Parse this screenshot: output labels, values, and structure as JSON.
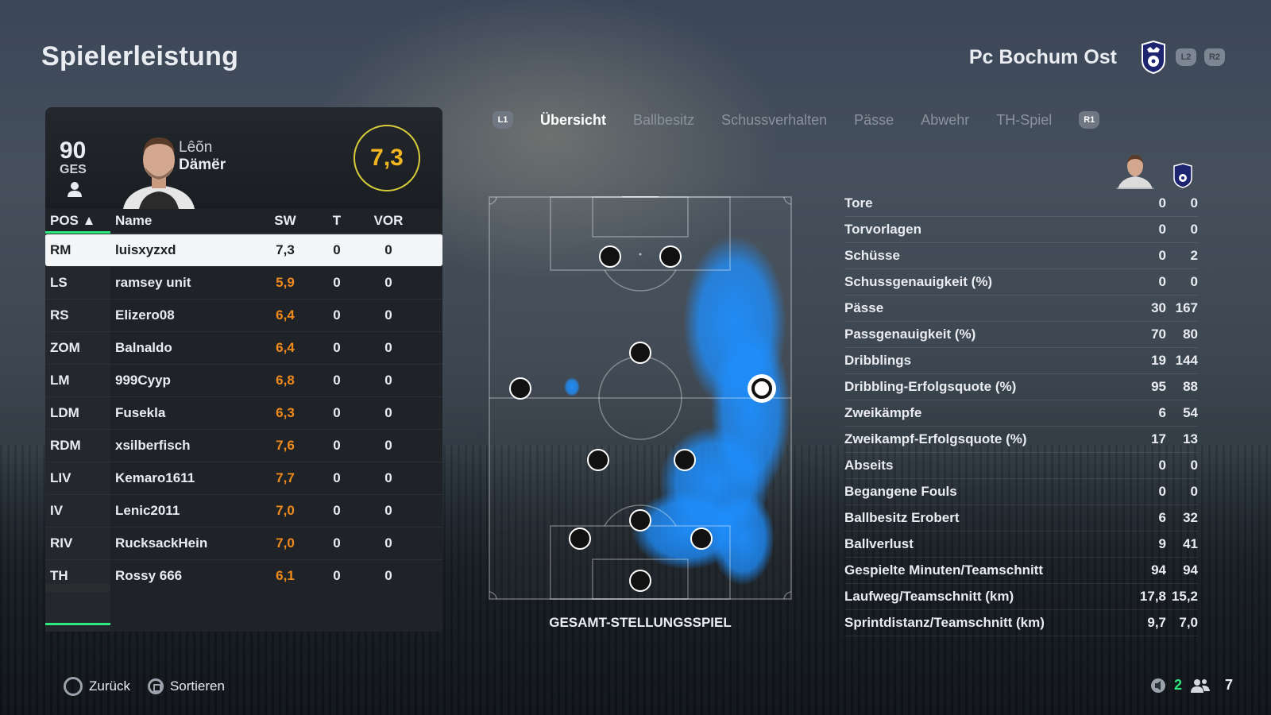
{
  "page_title": "Spielerleistung",
  "club": {
    "name": "Pc Bochum Ost",
    "l2": "L2",
    "r2": "R2"
  },
  "player": {
    "overall": "90",
    "overall_label": "GES",
    "first_name": "Lêõn",
    "last_name": "Dämër",
    "rating": "7,3"
  },
  "table": {
    "headers": {
      "pos": "POS ▲",
      "name": "Name",
      "sw": "SW",
      "t": "T",
      "vor": "VOR"
    },
    "rows": [
      {
        "pos": "RM",
        "name": "luisxyzxd",
        "sw": "7,3",
        "t": "0",
        "vor": "0"
      },
      {
        "pos": "LS",
        "name": "ramsey unit",
        "sw": "5,9",
        "t": "0",
        "vor": "0"
      },
      {
        "pos": "RS",
        "name": "Elizero08",
        "sw": "6,4",
        "t": "0",
        "vor": "0"
      },
      {
        "pos": "ZOM",
        "name": "Balnaldo",
        "sw": "6,4",
        "t": "0",
        "vor": "0"
      },
      {
        "pos": "LM",
        "name": "999Cyyp",
        "sw": "6,8",
        "t": "0",
        "vor": "0"
      },
      {
        "pos": "LDM",
        "name": "Fusekla",
        "sw": "6,3",
        "t": "0",
        "vor": "0"
      },
      {
        "pos": "RDM",
        "name": "xsilberfisch",
        "sw": "7,6",
        "t": "0",
        "vor": "0"
      },
      {
        "pos": "LIV",
        "name": "Kemaro1611",
        "sw": "7,7",
        "t": "0",
        "vor": "0"
      },
      {
        "pos": "IV",
        "name": "Lenic2011",
        "sw": "7,0",
        "t": "0",
        "vor": "0"
      },
      {
        "pos": "RIV",
        "name": "RucksackHein",
        "sw": "7,0",
        "t": "0",
        "vor": "0"
      },
      {
        "pos": "TH",
        "name": "Rossy 666",
        "sw": "6,1",
        "t": "0",
        "vor": "0"
      }
    ]
  },
  "tabs": {
    "l1": "L1",
    "r1": "R1",
    "items": [
      "Übersicht",
      "Ballbesitz",
      "Schussverhalten",
      "Pässe",
      "Abwehr",
      "TH-Spiel"
    ]
  },
  "pitch": {
    "caption": "GESAMT-STELLUNGSSPIEL"
  },
  "stats": [
    {
      "label": "Tore",
      "player": "0",
      "team": "0"
    },
    {
      "label": "Torvorlagen",
      "player": "0",
      "team": "0"
    },
    {
      "label": "Schüsse",
      "player": "0",
      "team": "2"
    },
    {
      "label": "Schussgenauigkeit (%)",
      "player": "0",
      "team": "0"
    },
    {
      "label": "Pässe",
      "player": "30",
      "team": "167"
    },
    {
      "label": "Passgenauigkeit (%)",
      "player": "70",
      "team": "80"
    },
    {
      "label": "Dribblings",
      "player": "19",
      "team": "144"
    },
    {
      "label": "Dribbling-Erfolgsquote (%)",
      "player": "95",
      "team": "88"
    },
    {
      "label": "Zweikämpfe",
      "player": "6",
      "team": "54"
    },
    {
      "label": "Zweikampf-Erfolgsquote (%)",
      "player": "17",
      "team": "13"
    },
    {
      "label": "Abseits",
      "player": "0",
      "team": "0"
    },
    {
      "label": "Begangene Fouls",
      "player": "0",
      "team": "0"
    },
    {
      "label": "Ballbesitz Erobert",
      "player": "6",
      "team": "32"
    },
    {
      "label": "Ballverlust",
      "player": "9",
      "team": "41"
    },
    {
      "label": "Gespielte Minuten/Teamschnitt",
      "player": "94",
      "team": "94"
    },
    {
      "label": "Laufweg/Teamschnitt (km)",
      "player": "17,8",
      "team": "15,2"
    },
    {
      "label": "Sprintdistanz/Teamschnitt (km)",
      "player": "9,7",
      "team": "7,0"
    }
  ],
  "footer": {
    "back": "Zurück",
    "sort": "Sortieren",
    "count_a": "2",
    "count_b": "7"
  },
  "colors": {
    "accent_green": "#2ee77e",
    "rating_orange": "#f08a1c",
    "rating_gold": "#f0b521",
    "heatmap_blue": "#1e8fff"
  }
}
